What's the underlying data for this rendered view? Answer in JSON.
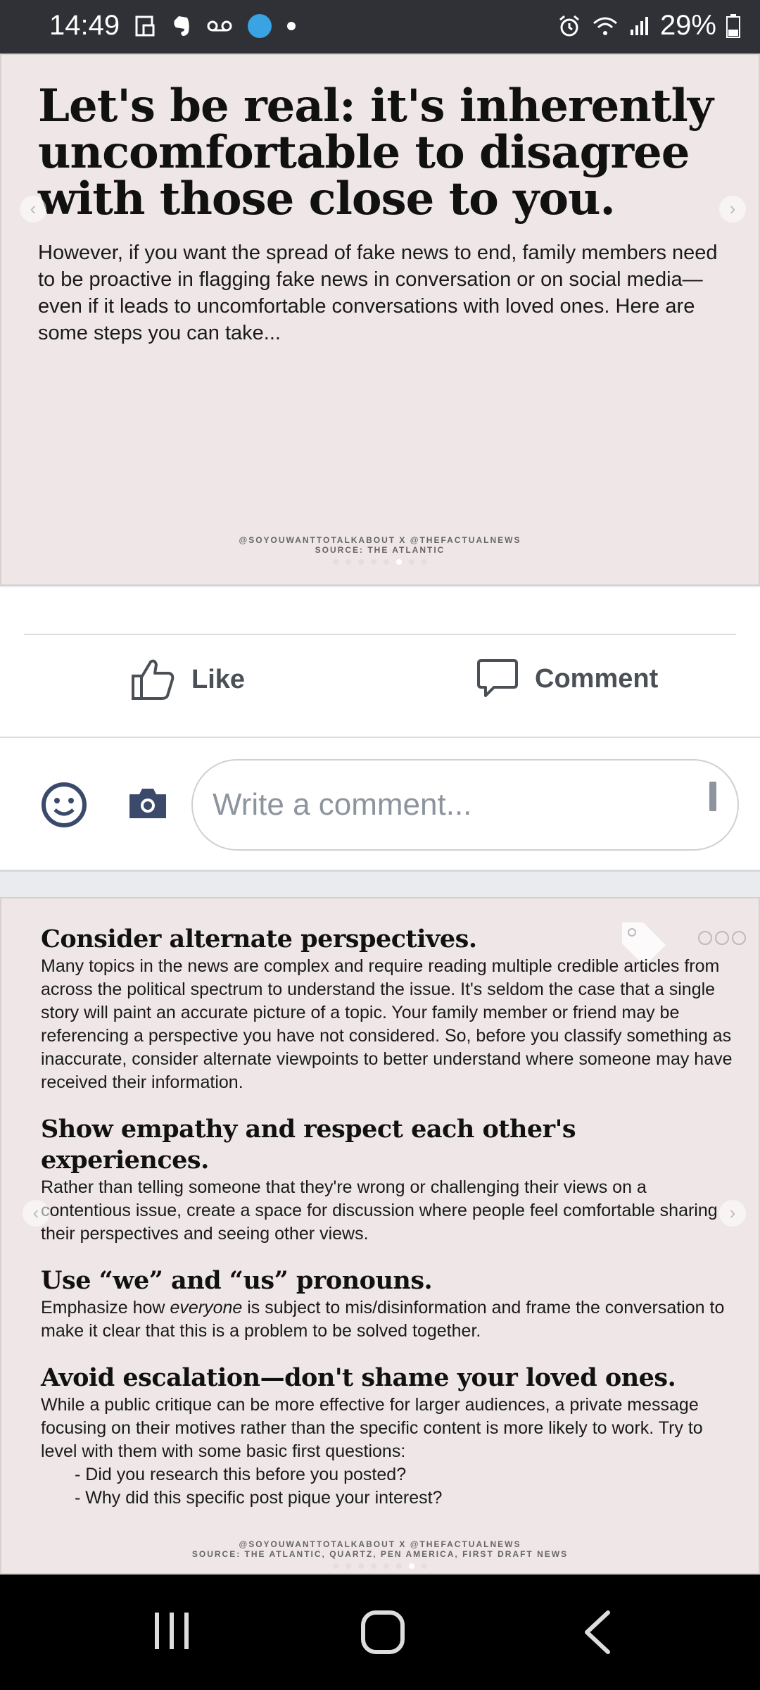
{
  "status_bar": {
    "time": "14:49",
    "battery": "29%",
    "left_icons": [
      "screenshot-icon",
      "evernote-icon",
      "voicemail-icon",
      "location-icon",
      "dot-icon"
    ],
    "right_icons": [
      "alarm-icon",
      "wifi-icon",
      "signal-icon",
      "battery-icon"
    ]
  },
  "post1": {
    "headline": "Let's be real: it's inherently uncomfortable to disagree with those close to you.",
    "body": "However, if you want the spread of fake news to end, family members need to be proactive in flagging fake news in conversation or on social media—even if it leads to uncomfortable conversations with loved ones. Here are some steps you can take...",
    "credit_line1": "@SOYOUWANTTOTALKABOUT X @THEFACTUALNEWS",
    "credit_line2": "SOURCE: THE ATLANTIC"
  },
  "actions": {
    "like_label": "Like",
    "comment_label": "Comment"
  },
  "comment_box": {
    "placeholder": "Write a comment..."
  },
  "post2": {
    "sections": [
      {
        "title": "Consider alternate perspectives.",
        "body": "Many topics in the news are complex and require reading multiple credible articles from across the political spectrum to understand the issue. It's seldom the case that a single story will paint an accurate picture of a topic. Your family member or friend may be referencing a perspective you have not considered. So, before you classify something as inaccurate, consider alternate viewpoints to better understand where someone may have received their information."
      },
      {
        "title": "Show empathy and respect each other's experiences.",
        "body": "Rather than telling someone that they're wrong or challenging their views on a contentious issue, create a space for discussion where people feel comfortable sharing their perspectives and seeing other views."
      },
      {
        "title": "Use “we” and “us” pronouns.",
        "body_before": "Emphasize how ",
        "body_em": "everyone",
        "body_after": " is subject to mis/disinformation and frame the conversation to make it clear that this is a problem to be solved together."
      },
      {
        "title": "Avoid escalation—don't shame your loved ones.",
        "body": "While a public critique can be more effective for larger audiences, a private message focusing on their motives rather than the specific content is more likely to work. Try to level with them with some basic first questions:",
        "bullets": [
          "- Did you research this before you posted?",
          "- Why did this specific post pique your interest?"
        ]
      }
    ],
    "credit_line1": "@SOYOUWANTTOTALKABOUT X @THEFACTUALNEWS",
    "credit_line2": "SOURCE: THE ATLANTIC, QUARTZ, PEN AMERICA, FIRST DRAFT NEWS"
  },
  "nav_bar": {
    "icons": [
      "recent-apps-icon",
      "home-icon",
      "back-icon"
    ]
  },
  "colors": {
    "slide_bg": "#efe7e7",
    "action_text": "#4b4f56",
    "status_bar": "#2f3136"
  }
}
